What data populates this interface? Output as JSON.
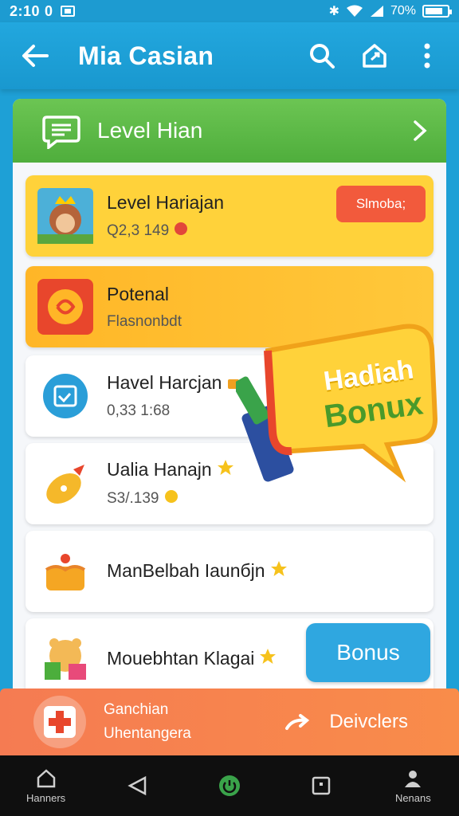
{
  "status": {
    "time": "2:10",
    "signal": "0",
    "battery": "70%"
  },
  "appbar": {
    "title": "Mia Casian"
  },
  "level_header": {
    "label": "Level Hian"
  },
  "cards": [
    {
      "name": "Level Hariajan",
      "sub": "Q2,3 149",
      "button": "Slmoba;"
    },
    {
      "name": "Potenal",
      "sub": "Flasnonbdt"
    },
    {
      "name": "Havel Harcjan",
      "sub": "0,33 1:68"
    },
    {
      "name": "Ualia Hanajn",
      "sub": "S3/.139"
    },
    {
      "name": "ManBelbah Iaunбjn",
      "sub": ""
    },
    {
      "name": "Mouebhtan Klagai",
      "sub": "",
      "button": "Bonus"
    }
  ],
  "gift": {
    "line1": "Hadiah",
    "line2": "Bonux"
  },
  "promo": {
    "line1": "Ganchian",
    "line2": "Uhentangera",
    "action": "Deivclers"
  },
  "nav": {
    "home": "Hanners",
    "profile": "Nenans"
  },
  "colors": {
    "primary": "#1ea0d6",
    "green": "#4fae3c",
    "yellow": "#ffd23a",
    "orange": "#f98c4a",
    "red": "#f25a3c"
  }
}
